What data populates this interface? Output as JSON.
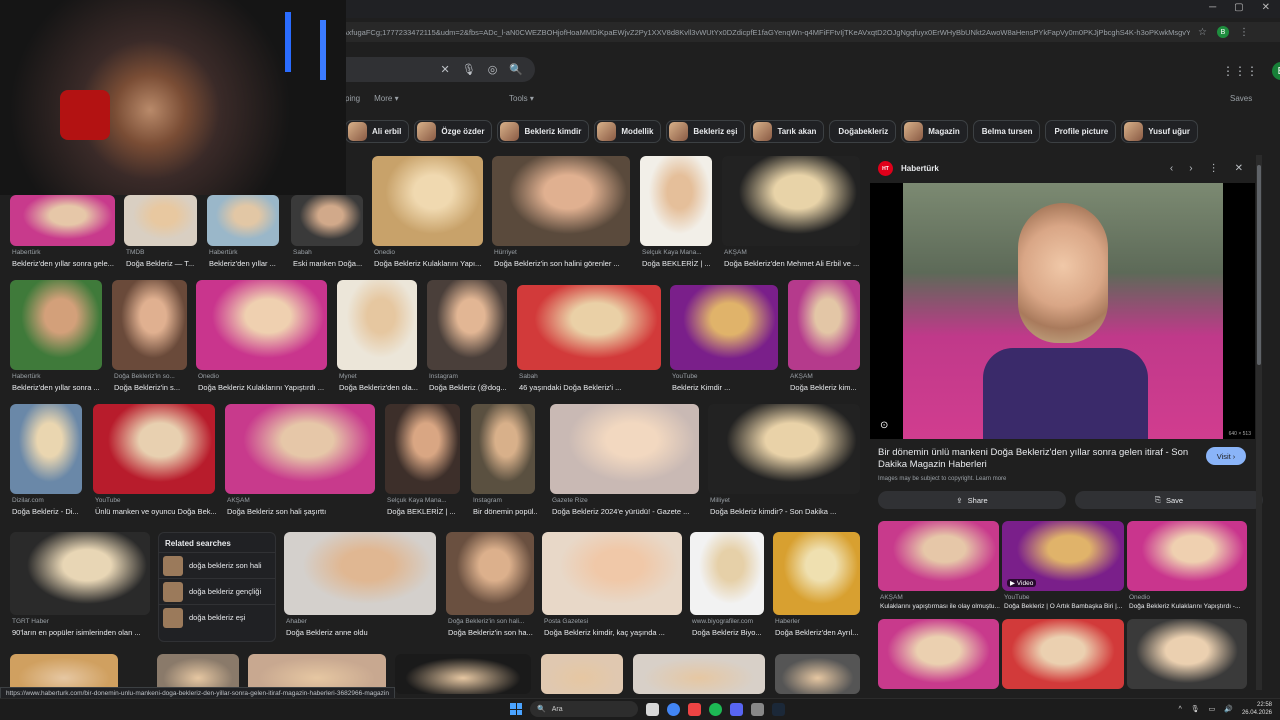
{
  "browser": {
    "url": "rAxfugaFCg;1777233472115&udm=2&fbs=ADc_l-aN0CWEZBOHjofHoaMMDiKpaEWjvZ2Py1XXV8d8Kvll3vWUtYx0DZdicpfE1faGYenqWn-q4MFiFFtvIjTKeAVxqtD2OJgNgqfuyx0ErWHyBbUNkt2AwoW8aHensPYkFapVy0m0PKJjPbcghS4K-h3oPKwkMsgvYNhnal4XYoD5NlgNdTzZzk...",
    "profile_initial": "B"
  },
  "search": {
    "apps_icon": "apps-grid-icon",
    "avatar_initial": "B"
  },
  "nav": {
    "item_partial": "ping",
    "more": "More ▾",
    "tools": "Tools ▾",
    "saves": "Saves"
  },
  "chips": [
    {
      "label": "Ali erbil",
      "img": true
    },
    {
      "label": "Özge özder",
      "img": true
    },
    {
      "label": "Bekleriz kimdir",
      "img": true
    },
    {
      "label": "Modellik",
      "img": true
    },
    {
      "label": "Bekleriz eşi",
      "img": true
    },
    {
      "label": "Tarık akan",
      "img": true
    },
    {
      "label": "Doğabekleriz",
      "img": false
    },
    {
      "label": "Magazin",
      "img": true
    },
    {
      "label": "Belma tursen",
      "img": false
    },
    {
      "label": "Profile picture",
      "img": false
    },
    {
      "label": "Yusuf uğur",
      "img": true
    }
  ],
  "results": [
    {
      "src": "Habertürk",
      "title": "Bekleriz'den yıllar sonra gele..."
    },
    {
      "src": "TMDB",
      "title": "Doğa Bekleriz — T..."
    },
    {
      "src": "Habertürk",
      "title": "Bekleriz'den yıllar ..."
    },
    {
      "src": "Sabah",
      "title": "Eski manken Doğa..."
    },
    {
      "src": "Onedio",
      "title": "Doğa Bekleriz Kulaklarını Yapı..."
    },
    {
      "src": "Hürriyet",
      "title": "Doğa Bekleriz'in son halini görenler ..."
    },
    {
      "src": "Selçuk Kaya Mana...",
      "title": "Doğa BEKLERİZ | ..."
    },
    {
      "src": "AKŞAM",
      "title": "Doğa Bekleriz'den Mehmet Ali Erbil ve ..."
    },
    {
      "src": "Habertürk",
      "title": "Bekleriz'den yıllar sonra ..."
    },
    {
      "src": "Doğa Bekleriz'in so...",
      "title": "Doğa Bekleriz'in s..."
    },
    {
      "src": "Onedio",
      "title": "Doğa Bekleriz Kulaklarını Yapıştırdı ..."
    },
    {
      "src": "Mynet",
      "title": "Doğa Bekleriz'den ola..."
    },
    {
      "src": "Instagram",
      "title": "Doğa Bekleriz (@dog..."
    },
    {
      "src": "Sabah",
      "title": "46 yaşındaki Doğa Bekleriz'i ..."
    },
    {
      "src": "YouTube",
      "title": "Bekleriz Kimdir ..."
    },
    {
      "src": "AKŞAM",
      "title": "Doğa Bekleriz kim..."
    },
    {
      "src": "Dizilar.com",
      "title": "Doğa Bekleriz - Di..."
    },
    {
      "src": "YouTube",
      "title": "Ünlü manken ve oyuncu Doğa Bek..."
    },
    {
      "src": "AKŞAM",
      "title": "Doğa Bekleriz son hali şaşırttı"
    },
    {
      "src": "Selçuk Kaya Mana...",
      "title": "Doğa BEKLERİZ | ..."
    },
    {
      "src": "Instagram",
      "title": "Bir dönemin popül..."
    },
    {
      "src": "Gazete Rize",
      "title": "Doğa Bekleriz 2024'e yürüdü! - Gazete ..."
    },
    {
      "src": "Milliyet",
      "title": "Doğa Bekleriz kimdir? - Son Dakika ..."
    },
    {
      "src": "TGRT Haber",
      "title": "90'ların en popüler isimlerinden olan ..."
    },
    {
      "src": "Ahaber",
      "title": "Doğa Bekleriz anne oldu"
    },
    {
      "src": "Doğa Bekleriz'in son hali...",
      "title": "Doğa Bekleriz'in son ha..."
    },
    {
      "src": "Posta Gazetesi",
      "title": "Doğa Bekleriz kimdir, kaç yaşında ..."
    },
    {
      "src": "www.biyografiler.com",
      "title": "Doğa Bekleriz Biyo..."
    },
    {
      "src": "Haberler",
      "title": "Doğa Bekleriz'den Ayrıl..."
    }
  ],
  "related": {
    "title": "Related searches",
    "items": [
      "doğa bekleriz son hali",
      "doğa bekleriz gençliği",
      "doğa bekleriz eşi"
    ]
  },
  "panel": {
    "source": "Habertürk",
    "title": "Bir dönemin ünlü mankeni Doğa Bekleriz'den yıllar sonra gelen itiraf - Son Dakika Magazin Haberleri",
    "visit": "Visit ›",
    "copyright": "Images may be subject to copyright. Learn more",
    "dims": "640 × 513",
    "share": "Share",
    "save": "Save",
    "related": [
      {
        "src": "AKŞAM",
        "title": "Kulaklarını yapıştırması ile olay olmuştu..."
      },
      {
        "src": "YouTube",
        "title": "Doğa Bekleriz | O Artık Bambaşka Biri |..."
      },
      {
        "src": "Onedio",
        "title": "Doğa Bekleriz Kulaklarını Yapıştırdı -..."
      }
    ],
    "video_badge": "▶ Video"
  },
  "status_url": "https://www.haberturk.com/bir-donemin-unlu-mankeni-doga-bekleriz-den-yillar-sonra-gelen-itiraf-magazin-haberleri-3682966-magazin",
  "taskbar": {
    "search": "Ara",
    "time": "22:58",
    "date": "26.04.2026"
  },
  "colors": {
    "accent": "#8ab4f8",
    "bg": "#1f1f1f",
    "surface": "#303134"
  }
}
